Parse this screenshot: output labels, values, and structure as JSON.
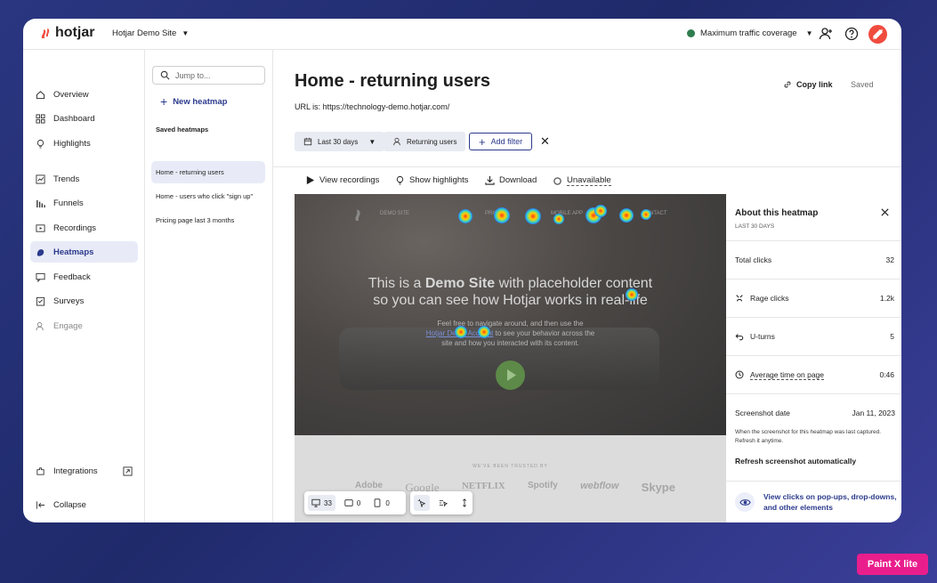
{
  "topbar": {
    "brand": "hotjar",
    "site_name": "Hotjar Demo Site",
    "coverage": "Maximum traffic coverage"
  },
  "nav": {
    "items": [
      {
        "label": "Overview",
        "icon": "home-icon"
      },
      {
        "label": "Dashboard",
        "icon": "dashboard-icon"
      },
      {
        "label": "Highlights",
        "icon": "bulb-icon"
      },
      {
        "label": "Trends",
        "icon": "trend-icon"
      },
      {
        "label": "Funnels",
        "icon": "funnel-icon"
      },
      {
        "label": "Recordings",
        "icon": "recordings-icon"
      },
      {
        "label": "Heatmaps",
        "icon": "heatmap-icon"
      },
      {
        "label": "Feedback",
        "icon": "feedback-icon"
      },
      {
        "label": "Surveys",
        "icon": "survey-icon"
      },
      {
        "label": "Engage",
        "icon": "engage-icon"
      }
    ],
    "integrations": "Integrations",
    "collapse": "Collapse"
  },
  "heatmap_list": {
    "search_placeholder": "Jump to...",
    "new_label": "New heatmap",
    "saved_label": "Saved heatmaps",
    "items": [
      "Home - returning users",
      "Home - users who click \"sign up\"",
      "Pricing page last 3 months"
    ]
  },
  "main": {
    "title": "Home - returning users",
    "url": "URL is: https://technology-demo.hotjar.com/",
    "copy_link": "Copy link",
    "saved_status": "Saved",
    "filters": {
      "date": "Last 30 days",
      "segment": "Returning users",
      "add_filter": "Add filter"
    },
    "tools": {
      "view_recordings": "View recordings",
      "show_highlights": "Show highlights",
      "download": "Download",
      "unavailable": "Unavailable"
    }
  },
  "preview": {
    "site_nav": [
      "DEMO SITE",
      "PRICING",
      "MOBILE APP",
      "CONTACT"
    ],
    "headline_a": "This is a ",
    "headline_b": "Demo Site",
    "headline_c": " with placeholder content",
    "headline_2": "so you can see how Hotjar works in real-life",
    "para_1": "Feel free to navigate around, and then use the",
    "para_link": "Hotjar Demo Account",
    "para_2": " to see your behavior across the",
    "para_3": "site and how you interacted with its content.",
    "trusted": "WE'VE BEEN TRUSTED BY",
    "brands": [
      "Adobe",
      "Google",
      "NETFLIX",
      "Spotify",
      "webflow",
      "Skype"
    ]
  },
  "device_toolbar": {
    "desktop": "33",
    "tablet": "0",
    "mobile": "0"
  },
  "about": {
    "title": "About this heatmap",
    "subtitle": "LAST 30 DAYS",
    "metrics": [
      {
        "label": "Total clicks",
        "value": "32",
        "icon": ""
      },
      {
        "label": "Rage clicks",
        "value": "1.2k",
        "icon": "rage-icon"
      },
      {
        "label": "U-turns",
        "value": "5",
        "icon": "uturn-icon"
      },
      {
        "label": "Average time on page",
        "value": "0:46",
        "icon": "clock-icon"
      }
    ],
    "screenshot_date_label": "Screenshot date",
    "screenshot_date": "Jan 11, 2023",
    "screenshot_desc": "When the screenshot for this heatmap was last captured. Refresh it anytime.",
    "refresh": "Refresh screenshot automatically",
    "popups": "View clicks on pop-ups, drop-downs, and other elements"
  },
  "watermark": "Paint X lite",
  "colors": {
    "accent": "#2b3a8c",
    "brand": "#f04c3e",
    "coverage_dot": "#2e7d4f"
  }
}
